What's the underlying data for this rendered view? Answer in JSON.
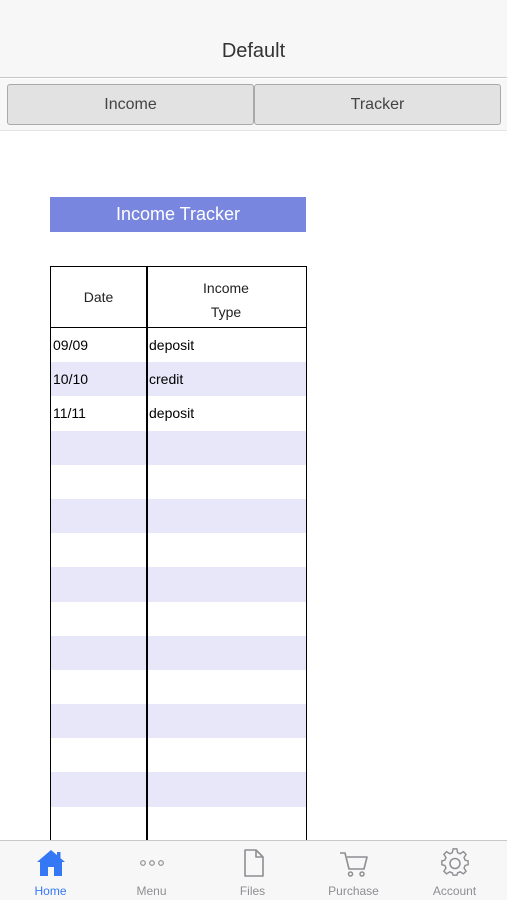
{
  "header": {
    "title": "Default"
  },
  "segments": [
    {
      "label": "Income"
    },
    {
      "label": "Tracker"
    }
  ],
  "tracker": {
    "title": "Income Tracker",
    "columns": {
      "date": "Date",
      "type_line1": "Income",
      "type_line2": "Type"
    },
    "rows": [
      {
        "date": "09/09",
        "type": "deposit"
      },
      {
        "date": "10/10",
        "type": "credit"
      },
      {
        "date": "11/11",
        "type": "deposit"
      },
      {
        "date": "",
        "type": ""
      },
      {
        "date": "",
        "type": ""
      },
      {
        "date": "",
        "type": ""
      },
      {
        "date": "",
        "type": ""
      },
      {
        "date": "",
        "type": ""
      },
      {
        "date": "",
        "type": ""
      },
      {
        "date": "",
        "type": ""
      },
      {
        "date": "",
        "type": ""
      },
      {
        "date": "",
        "type": ""
      },
      {
        "date": "",
        "type": ""
      },
      {
        "date": "",
        "type": ""
      },
      {
        "date": "",
        "type": ""
      }
    ]
  },
  "tabbar": {
    "active": "home",
    "items": [
      {
        "id": "home",
        "label": "Home",
        "icon": "home-icon"
      },
      {
        "id": "menu",
        "label": "Menu",
        "icon": "more-dots-icon"
      },
      {
        "id": "files",
        "label": "Files",
        "icon": "file-icon"
      },
      {
        "id": "purchase",
        "label": "Purchase",
        "icon": "cart-icon"
      },
      {
        "id": "account",
        "label": "Account",
        "icon": "gear-icon"
      }
    ]
  },
  "colors": {
    "accent": "#3478f6",
    "title_band": "#7986df",
    "row_alt": "#e7e7f9"
  }
}
